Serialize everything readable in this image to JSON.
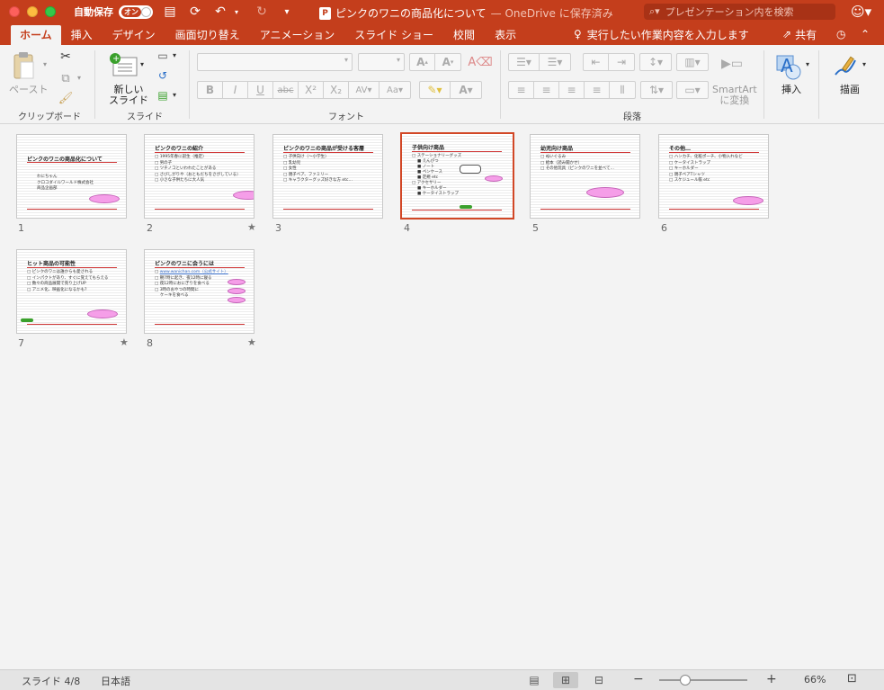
{
  "titlebar": {
    "autosave_label": "自動保存",
    "autosave_toggle": "オン",
    "doc_title": "ピンクのワニの商品化について",
    "doc_status": " — OneDrive に保存済み",
    "search_placeholder": "プレゼンテーション内を検索"
  },
  "tabs": [
    "ホーム",
    "挿入",
    "デザイン",
    "画面切り替え",
    "アニメーション",
    "スライド ショー",
    "校閲",
    "表示"
  ],
  "tell_me": "実行したい作業内容を入力します",
  "share": "共有",
  "ribbon": {
    "paste_label": "ペースト",
    "new_slide_label_1": "新しい",
    "new_slide_label_2": "スライド",
    "group_clipboard": "クリップボード",
    "group_slides": "スライド",
    "group_font": "フォント",
    "group_paragraph": "段落",
    "smartart_1": "SmartArt",
    "smartart_2": "に変換",
    "insert_label": "挿入",
    "draw_label": "描画"
  },
  "slides": [
    {
      "number": "1",
      "title": "ピンクのワニの商品化について",
      "bullets": [
        "わにちゃん",
        "クロコダイルワールド株式会社",
        "商品企画部"
      ]
    },
    {
      "number": "2",
      "title": "ピンクのワニの紹介",
      "bullets": [
        "1995年春に誕生（推定）",
        "男の子",
        "ツチノコといわれたことがある",
        "さびしがりや（おともだちをさがしている）",
        "小さな子供たちに大人気"
      ]
    },
    {
      "number": "3",
      "title": "ピンクのワニの商品が受ける客層",
      "bullets": [
        "子供向け（～小学生）",
        "乳幼児",
        "女性",
        "親子ペア、ファミリー",
        "キャラクターグッズ好きな方 etc…"
      ]
    },
    {
      "number": "4",
      "title": "子供向け商品",
      "bullets": [
        "ステーショナリーグッズ",
        "えんぴつ",
        "ノート",
        "ペンケース",
        "定規 etc",
        "アクセサリー",
        "キーホルダー",
        "ケータイストラップ"
      ]
    },
    {
      "number": "5",
      "title": "幼児向け商品",
      "bullets": [
        "ぬいぐるみ",
        "絵本（読み聞かせ）",
        "その他玩具（ピンクのワニを並べて…"
      ]
    },
    {
      "number": "6",
      "title": "その他…",
      "bullets": [
        "ハンカチ、化粧ポーチ、小物入れなど",
        "ケータイストラップ",
        "キーホルダー",
        "親子ペアTシャツ",
        "スケジュール帳 etc"
      ]
    },
    {
      "number": "7",
      "title": "ヒット商品の可能性",
      "bullets": [
        "ピンクのワニは誰からも愛される",
        "インパクトがあり、すぐに覚えてもらえる",
        "数々の商品展開で売り上げUP",
        "アニメ化、映画化になるかも？"
      ]
    },
    {
      "number": "8",
      "title": "ピンクのワニに会うには",
      "bullets": [
        "www.wanichan.com（公式サイト）",
        "朝7時に起き、夜12時に寝る",
        "夜12時におにぎりを食べる",
        "3時のおやつの時間に",
        "ケーキを食べる"
      ]
    }
  ],
  "statusbar": {
    "slide_info": "スライド 4/8",
    "language": "日本語",
    "zoom": "66%",
    "zoom_fraction": 0.3
  }
}
